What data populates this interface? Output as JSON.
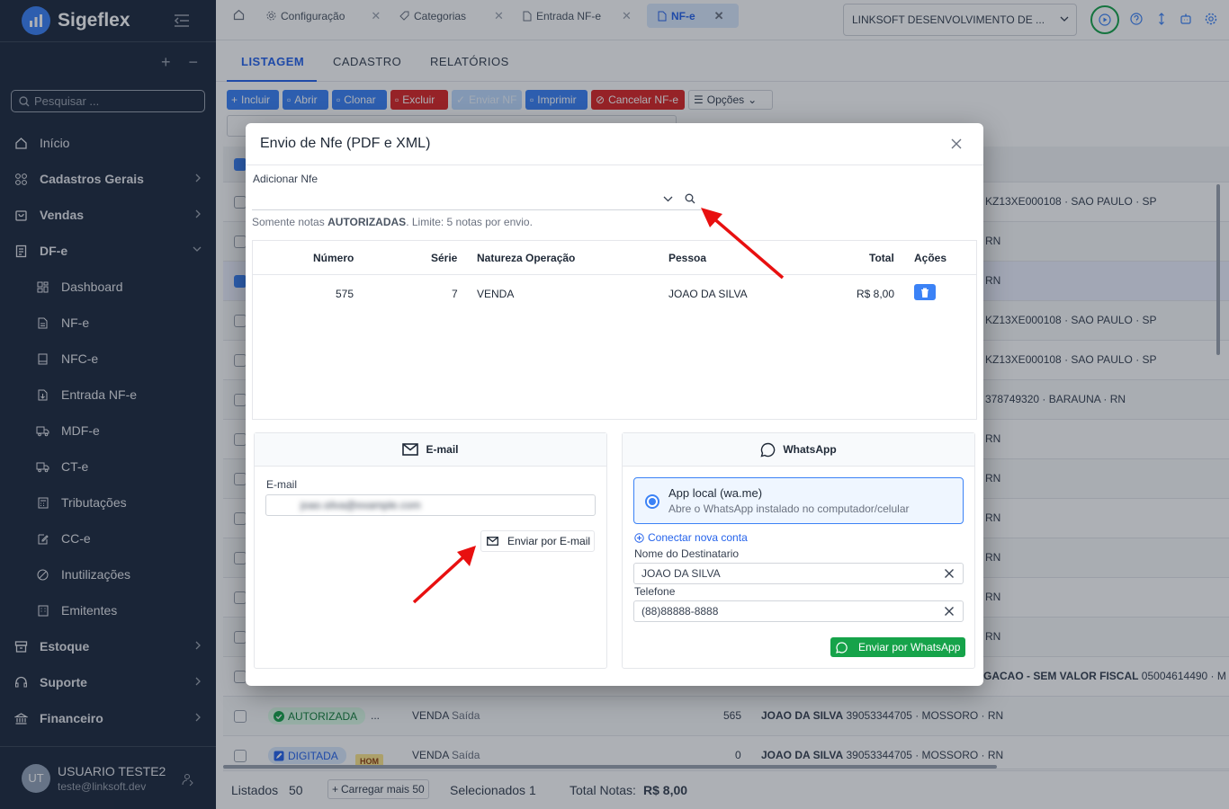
{
  "app": {
    "name": "Sigeflex"
  },
  "sidebar": {
    "search_placeholder": "Pesquisar ...",
    "items": [
      {
        "label": "Início"
      },
      {
        "label": "Cadastros Gerais"
      },
      {
        "label": "Vendas"
      },
      {
        "label": "DF-e"
      },
      {
        "label": "Dashboard"
      },
      {
        "label": "NF-e"
      },
      {
        "label": "NFC-e"
      },
      {
        "label": "Entrada NF-e"
      },
      {
        "label": "MDF-e"
      },
      {
        "label": "CT-e"
      },
      {
        "label": "Tributações"
      },
      {
        "label": "CC-e"
      },
      {
        "label": "Inutilizações"
      },
      {
        "label": "Emitentes"
      },
      {
        "label": "Estoque"
      },
      {
        "label": "Suporte"
      },
      {
        "label": "Financeiro"
      }
    ],
    "user": {
      "initials": "UT",
      "name": "USUARIO TESTE2",
      "email": "teste@linksoft.dev"
    }
  },
  "tabs": [
    {
      "label": "Configuração"
    },
    {
      "label": "Categorias"
    },
    {
      "label": "Entrada NF-e"
    },
    {
      "label": "NF-e"
    }
  ],
  "company": "LINKSOFT DESENVOLVIMENTO DE ...",
  "subtabs": [
    "LISTAGEM",
    "CADASTRO",
    "RELATÓRIOS"
  ],
  "toolbar": {
    "incluir": "Incluir",
    "abrir": "Abrir",
    "clonar": "Clonar",
    "excluir": "Excluir",
    "enviar": "Enviar NF",
    "imprimir": "Imprimir",
    "cancelar": "Cancelar NF-e",
    "opcoes": "Opções"
  },
  "list": {
    "rows": [
      {
        "text": "KZ13XE000108 · SAO PAULO · SP"
      },
      {
        "text": "RN"
      },
      {
        "text": "RN"
      },
      {
        "text": "KZ13XE000108 · SAO PAULO · SP"
      },
      {
        "text": "KZ13XE000108 · SAO PAULO · SP"
      },
      {
        "text": "378749320 · BARAUNA · RN"
      },
      {
        "text": "RN"
      },
      {
        "text": "RN"
      },
      {
        "text": "RN"
      },
      {
        "text": "RN"
      },
      {
        "text": "RN"
      },
      {
        "text": "RN"
      },
      {
        "strong": "GACAO - SEM VALOR FISCAL",
        "text": "05004614490 · M"
      }
    ],
    "row_autorizada": {
      "status": "AUTORIZADA",
      "ellipsis": "...",
      "natureza": "VENDA",
      "tipo": "Saída",
      "numero": "565",
      "pessoa": "JOAO DA SILVA",
      "detail": "39053344705 · MOSSORO · RN"
    },
    "row_digitada": {
      "status": "DIGITADA",
      "env": "HOM",
      "natureza": "VENDA",
      "tipo": "Saída",
      "numero": "0",
      "pessoa": "JOAO DA SILVA",
      "detail": "39053344705 · MOSSORO · RN"
    }
  },
  "footer": {
    "listados_label": "Listados",
    "listados_value": "50",
    "carregar": "Carregar mais 50",
    "selecionados": "Selecionados 1",
    "total_label": "Total Notas:",
    "total_value": "R$ 8,00"
  },
  "modal": {
    "title": "Envio de Nfe (PDF e XML)",
    "add_label": "Adicionar Nfe",
    "add_value": "",
    "hint_prefix": "Somente notas",
    "hint_bold": "AUTORIZADAS",
    "hint_suffix": ". Limite: 5 notas por envio.",
    "table": {
      "headers": [
        "Número",
        "Série",
        "Natureza Operação",
        "Pessoa",
        "Total",
        "Ações"
      ],
      "rows": [
        {
          "numero": "575",
          "serie": "7",
          "natureza": "VENDA",
          "pessoa": "JOAO DA SILVA",
          "total": "R$ 8,00"
        }
      ]
    },
    "email": {
      "title": "E-mail",
      "label": "E-mail",
      "value": "joao.silva@example.com",
      "button": "Enviar por E-mail"
    },
    "whatsapp": {
      "title": "WhatsApp",
      "option_title": "App local (wa.me)",
      "option_desc": "Abre o WhatsApp instalado no computador/celular",
      "connect": "Conectar nova conta",
      "name_label": "Nome do Destinatario",
      "name_value": "JOAO DA SILVA",
      "phone_label": "Telefone",
      "phone_value": "(88)88888-8888",
      "button": "Enviar por WhatsApp"
    }
  },
  "colors": {
    "primary": "#3b82f6",
    "danger": "#dc2626",
    "success": "#16a34a",
    "sidebar": "#1e2a3e",
    "annotation": "#e81010"
  }
}
